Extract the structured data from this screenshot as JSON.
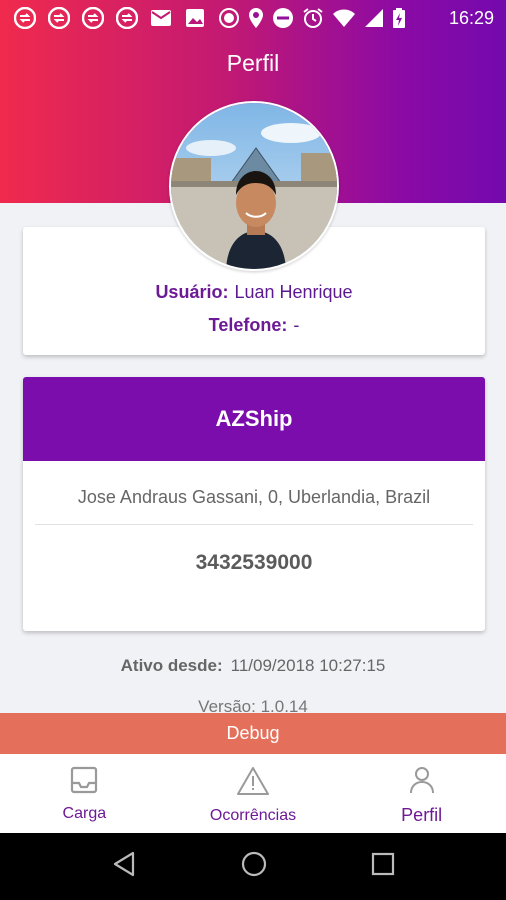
{
  "status_bar": {
    "time": "16:29",
    "left_icons": [
      "sync-icon",
      "sync-icon",
      "sync-icon",
      "sync-icon",
      "mail-icon",
      "image-icon",
      "record-icon"
    ],
    "right_icons": [
      "location-icon",
      "do-not-disturb-icon",
      "alarm-icon",
      "wifi-icon",
      "signal-icon",
      "battery-charging-icon"
    ]
  },
  "header": {
    "title": "Perfil"
  },
  "user": {
    "user_label": "Usuário:",
    "user_value": "Luan Henrique",
    "phone_label": "Telefone:",
    "phone_value": "-"
  },
  "company": {
    "name": "AZShip",
    "address": "Jose Andraus Gassani, 0, Uberlandia, Brazil",
    "phone": "3432539000"
  },
  "meta": {
    "active_label": "Ativo desde:",
    "active_value": "11/09/2018 10:27:15",
    "version_label": "Versão:",
    "version_value": "1.0.14"
  },
  "debug": {
    "label": "Debug"
  },
  "bottom_nav": {
    "items": [
      {
        "label": "Carga",
        "icon": "inbox-icon"
      },
      {
        "label": "Ocorrências",
        "icon": "warning-icon"
      },
      {
        "label": "Perfil",
        "icon": "person-icon"
      }
    ]
  },
  "colors": {
    "gradient_start": "#f02a4d",
    "gradient_end": "#7409ad",
    "brand_purple": "#7a0dac",
    "debug_bar": "#e4705c"
  }
}
